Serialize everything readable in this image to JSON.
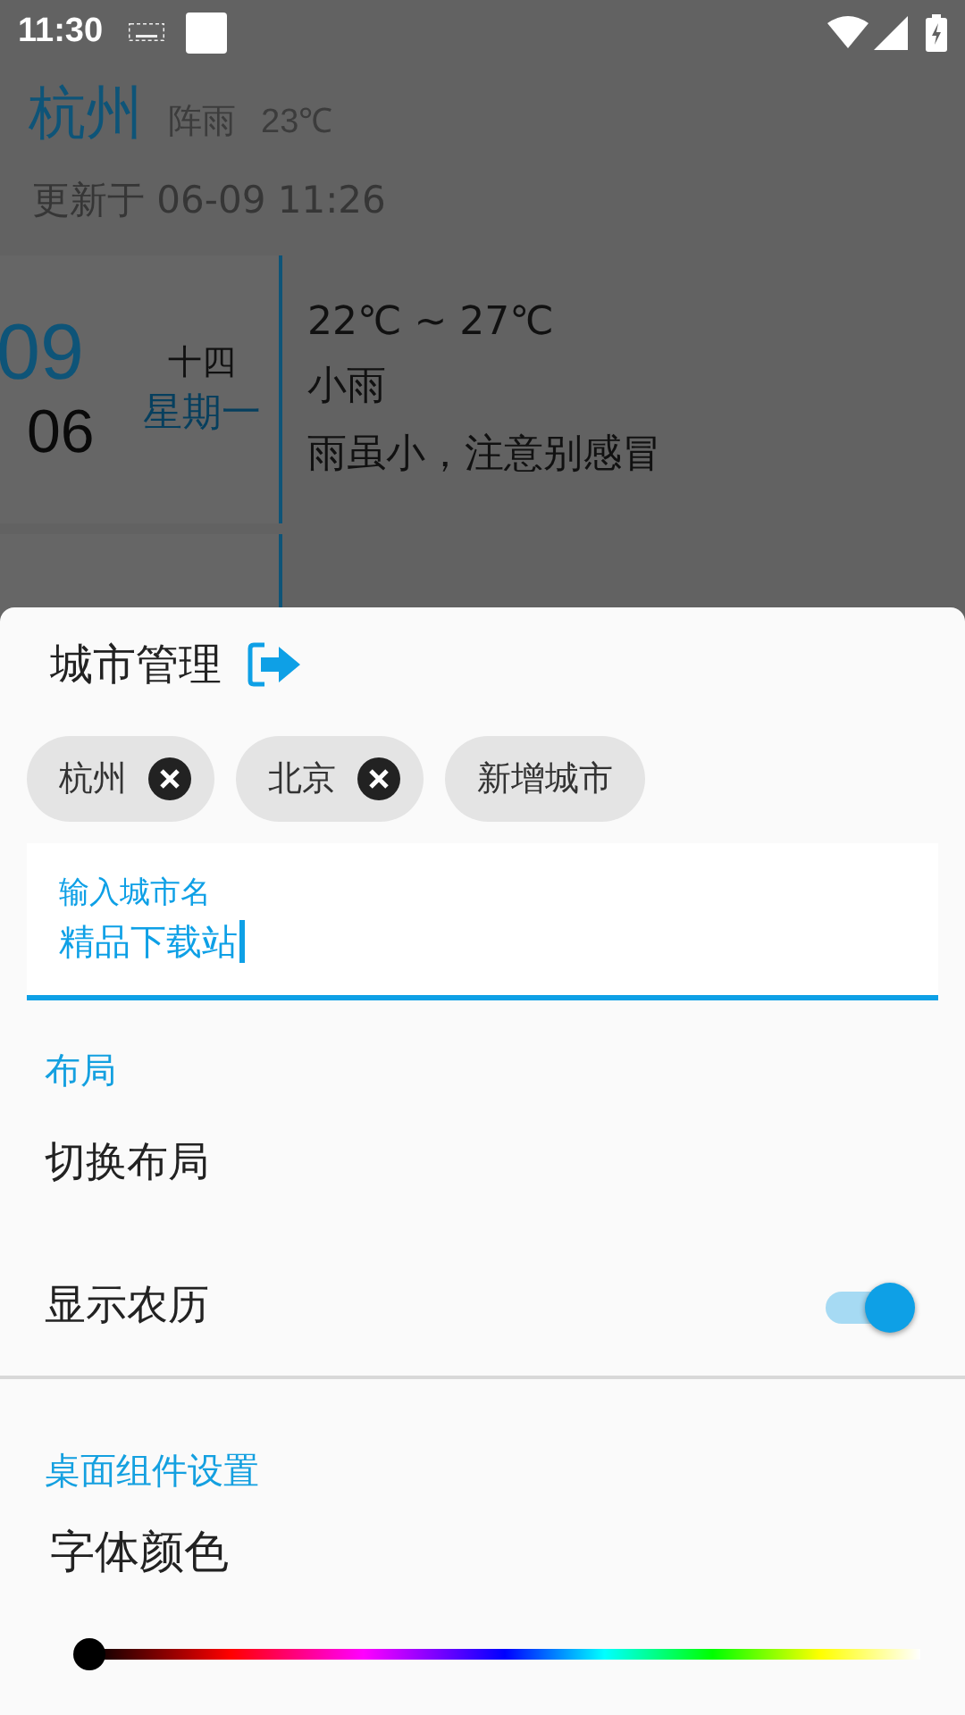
{
  "status_bar": {
    "time": "11:30"
  },
  "weather": {
    "city": "杭州",
    "condition": "阵雨",
    "temperature": "23℃",
    "updated": "更新于 06-09 11:26",
    "days": [
      {
        "day": "09",
        "month": "06",
        "lunar": "十四",
        "weekday": "星期一",
        "range": "22℃ ~ 27℃",
        "weather": "小雨",
        "tip": "雨虽小，注意别感冒"
      }
    ]
  },
  "sheet": {
    "title": "城市管理",
    "cities": [
      {
        "label": "杭州",
        "kind": "removable"
      },
      {
        "label": "北京",
        "kind": "removable"
      },
      {
        "label": "新增城市",
        "kind": "add"
      }
    ],
    "city_input": {
      "label": "输入城市名",
      "value": "精品下载站"
    },
    "sections": [
      {
        "title": "布局",
        "items": [
          {
            "kind": "action",
            "label": "切换布局"
          },
          {
            "kind": "switch",
            "label": "显示农历",
            "on": true
          }
        ]
      },
      {
        "title": "桌面组件设置",
        "items": [
          {
            "kind": "color_slider",
            "label": "字体颜色",
            "level": 0
          }
        ]
      }
    ]
  }
}
